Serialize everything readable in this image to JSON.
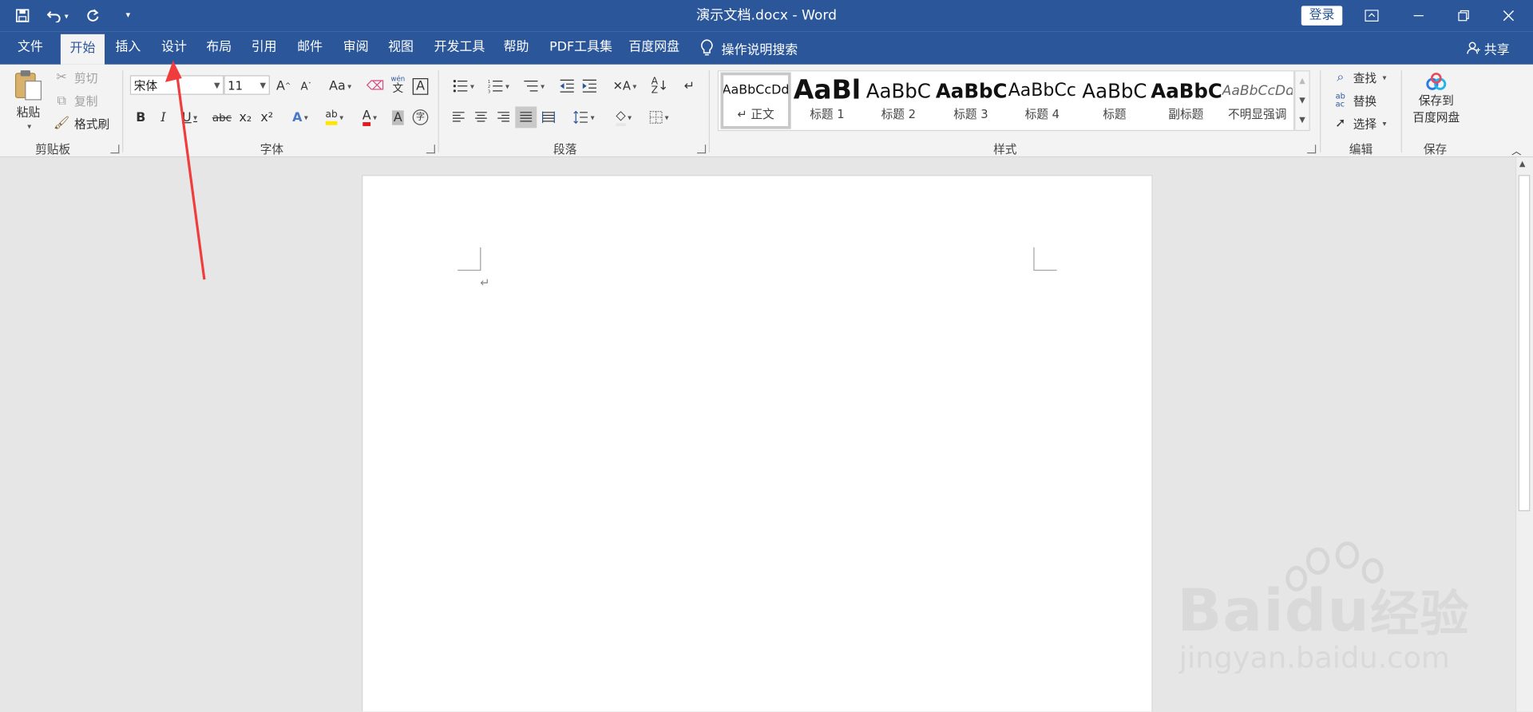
{
  "window": {
    "title": "演示文档.docx  -  Word",
    "login_label": "登录"
  },
  "tabs": [
    "文件",
    "开始",
    "插入",
    "设计",
    "布局",
    "引用",
    "邮件",
    "审阅",
    "视图",
    "开发工具",
    "帮助",
    "PDF工具集",
    "百度网盘"
  ],
  "active_tab": "开始",
  "tell_me": "操作说明搜索",
  "share_label": "共享",
  "clipboard": {
    "paste": "粘贴",
    "cut": "剪切",
    "copy": "复制",
    "format_painter": "格式刷",
    "group": "剪贴板"
  },
  "font": {
    "name": "宋体",
    "size": "11",
    "group": "字体",
    "bold": "B",
    "italic": "I",
    "underline": "U",
    "strike": "abc",
    "sub": "x₂",
    "sup": "x²",
    "grow": "A",
    "shrink": "A",
    "case": "Aa",
    "phonetic_top": "wén",
    "phonetic_bottom": "文",
    "border_char": "A",
    "effects": "A",
    "highlight": "ab",
    "color": "A",
    "shade": "A",
    "enclose": "字"
  },
  "paragraph": {
    "group": "段落"
  },
  "styles": {
    "group": "样式",
    "items": [
      {
        "preview": "AaBbCcDd",
        "label": "↵ 正文"
      },
      {
        "preview": "AaBl",
        "label": "标题 1"
      },
      {
        "preview": "AaBbC",
        "label": "标题 2"
      },
      {
        "preview": "AaBbC",
        "label": "标题 3"
      },
      {
        "preview": "AaBbCc",
        "label": "标题 4"
      },
      {
        "preview": "AaBbC",
        "label": "标题"
      },
      {
        "preview": "AaBbC",
        "label": "副标题"
      },
      {
        "preview": "AaBbCcDd",
        "label": "不明显强调"
      }
    ]
  },
  "editing": {
    "group": "编辑",
    "find": "查找",
    "replace": "替换",
    "select": "选择"
  },
  "save_cloud": {
    "line1": "保存到",
    "line2": "百度网盘",
    "group": "保存"
  },
  "document": {
    "paragraph_mark": "↵"
  },
  "watermark": {
    "brand_a": "Bai",
    "brand_b": "du",
    "brand_c": "经验",
    "url": "jingyan.baidu.com"
  },
  "colors": {
    "title_bar": "#2b579a",
    "ribbon": "#f3f3f3",
    "canvas": "#e6e6e6",
    "annotation_arrow": "#f03c3c"
  }
}
